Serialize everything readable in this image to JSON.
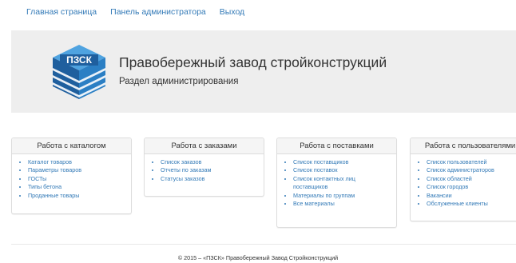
{
  "nav": {
    "home": "Главная страница",
    "admin": "Панель администратора",
    "logout": "Выход"
  },
  "header": {
    "logo_text": "ПЗСК",
    "title": "Правобережный завод стройконструкций",
    "subtitle": "Раздел администрирования"
  },
  "panels": [
    {
      "title": "Работа с каталогом",
      "items": [
        "Каталог товаров",
        "Параметры товаров",
        "ГОСТы",
        "Типы бетона",
        "Проданные товары"
      ]
    },
    {
      "title": "Работа с заказами",
      "items": [
        "Список заказов",
        "Отчеты по заказам",
        "Статусы заказов"
      ]
    },
    {
      "title": "Работа с поставками",
      "items": [
        "Список поставщиков",
        "Список поставок",
        "Список контактных лиц поставщиков",
        "Материалы по группам",
        "Все материалы"
      ]
    },
    {
      "title": "Работа с пользователями",
      "items": [
        "Список пользователей",
        "Список администраторов",
        "Список областей",
        "Список городов",
        "Вакансии",
        "Обслуженные клиенты"
      ]
    }
  ],
  "footer": "© 2015 – «ПЗСК» Правобережный Завод Стройконструкций",
  "colors": {
    "link": "#337ab7",
    "jumbotron": "#eeeeee",
    "logo_blue": "#2b7fc4"
  }
}
